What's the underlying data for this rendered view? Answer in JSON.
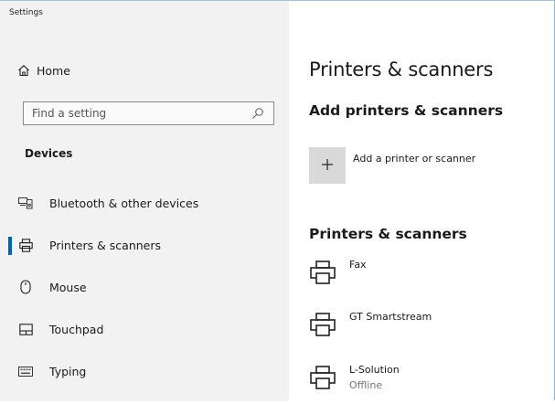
{
  "window": {
    "title": "Settings"
  },
  "sidebar": {
    "home_label": "Home",
    "search": {
      "placeholder": "Find a setting",
      "icon": "search-icon"
    },
    "section_heading": "Devices",
    "items": [
      {
        "label": "Bluetooth & other devices",
        "icon": "bluetooth-devices-icon",
        "active": false
      },
      {
        "label": "Printers & scanners",
        "icon": "printer-icon",
        "active": true
      },
      {
        "label": "Mouse",
        "icon": "mouse-icon",
        "active": false
      },
      {
        "label": "Touchpad",
        "icon": "touchpad-icon",
        "active": false
      },
      {
        "label": "Typing",
        "icon": "keyboard-icon",
        "active": false
      }
    ]
  },
  "main": {
    "title": "Printers & scanners",
    "add_section": {
      "heading": "Add printers & scanners",
      "button_label": "Add a printer or scanner"
    },
    "list_section": {
      "heading": "Printers & scanners",
      "printers": [
        {
          "name": "Fax",
          "status": ""
        },
        {
          "name": "GT Smartstream",
          "status": ""
        },
        {
          "name": "L-Solution",
          "status": "Offline"
        }
      ]
    }
  },
  "colors": {
    "sidebar_bg": "#f2f2f2",
    "accent": "#0063b1",
    "add_button_bg": "#d9d9d9"
  }
}
